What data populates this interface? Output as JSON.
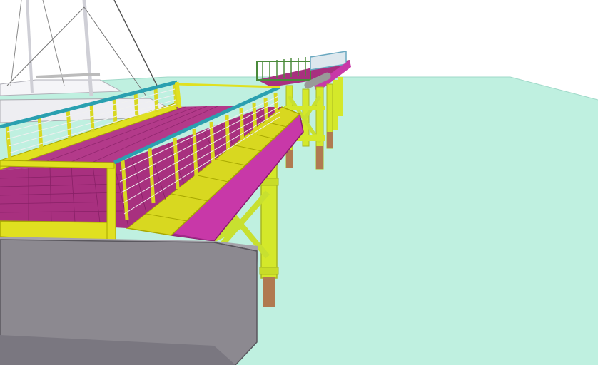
{
  "scene": {
    "type": "3d-cad-render",
    "subject": "pier",
    "colors": {
      "sky": "#ffffff",
      "water": "#bff0e0",
      "deck_grating": "#a8307f",
      "deck_grid": "#7a1a5c",
      "side_beam": "#c838a8",
      "walkway": "#d8d820",
      "walkway_edge": "#b8b800",
      "railing_post": "#e0e020",
      "handrail": "#2aa0b0",
      "pile": "#d4e82a",
      "pile_foot": "#b07a50",
      "bracing": "#c8e030",
      "concrete_block": "#8c8990",
      "concrete_top": "#a5a3aa",
      "far_rail_green": "#4a8a3a",
      "boat_hull": "#e8e8ee",
      "rigging": "#555555"
    }
  }
}
